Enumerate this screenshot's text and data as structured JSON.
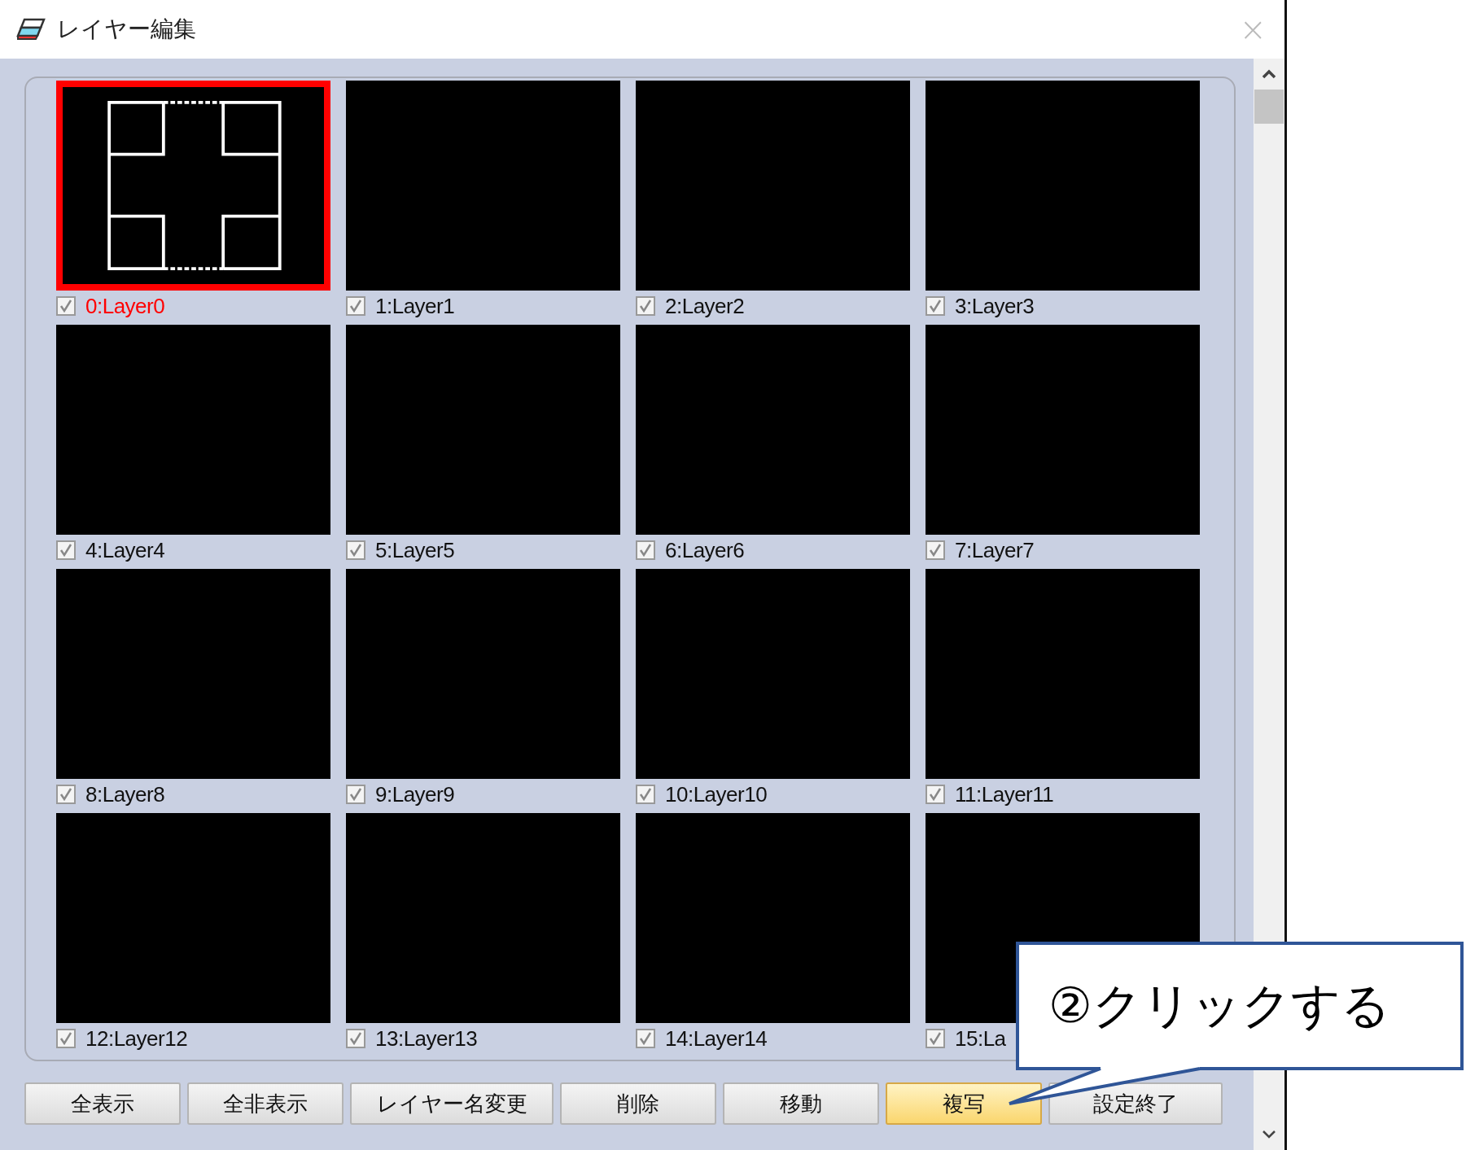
{
  "window": {
    "title": "レイヤー編集",
    "close": "×"
  },
  "layers": [
    {
      "name": "0:Layer0",
      "checked": true,
      "selected": true,
      "kind": "drawing"
    },
    {
      "name": "1:Layer1",
      "checked": true,
      "selected": false,
      "kind": "empty"
    },
    {
      "name": "2:Layer2",
      "checked": true,
      "selected": false,
      "kind": "empty"
    },
    {
      "name": "3:Layer3",
      "checked": true,
      "selected": false,
      "kind": "empty"
    },
    {
      "name": "4:Layer4",
      "checked": true,
      "selected": false,
      "kind": "empty"
    },
    {
      "name": "5:Layer5",
      "checked": true,
      "selected": false,
      "kind": "empty"
    },
    {
      "name": "6:Layer6",
      "checked": true,
      "selected": false,
      "kind": "empty"
    },
    {
      "name": "7:Layer7",
      "checked": true,
      "selected": false,
      "kind": "empty"
    },
    {
      "name": "8:Layer8",
      "checked": true,
      "selected": false,
      "kind": "empty"
    },
    {
      "name": "9:Layer9",
      "checked": true,
      "selected": false,
      "kind": "empty"
    },
    {
      "name": "10:Layer10",
      "checked": true,
      "selected": false,
      "kind": "empty"
    },
    {
      "name": "11:Layer11",
      "checked": true,
      "selected": false,
      "kind": "empty"
    },
    {
      "name": "12:Layer12",
      "checked": true,
      "selected": false,
      "kind": "empty"
    },
    {
      "name": "13:Layer13",
      "checked": true,
      "selected": false,
      "kind": "empty"
    },
    {
      "name": "14:Layer14",
      "checked": true,
      "selected": false,
      "kind": "empty"
    },
    {
      "name": "15:La",
      "checked": true,
      "selected": false,
      "kind": "empty"
    }
  ],
  "buttons": [
    {
      "label": "全表示",
      "highlighted": false
    },
    {
      "label": "全非表示",
      "highlighted": false
    },
    {
      "label": "レイヤー名変更",
      "highlighted": false
    },
    {
      "label": "削除",
      "highlighted": false
    },
    {
      "label": "移動",
      "highlighted": false
    },
    {
      "label": "複写",
      "highlighted": true
    },
    {
      "label": "設定終了",
      "highlighted": false
    }
  ],
  "callout": {
    "text": "②クリックする"
  }
}
